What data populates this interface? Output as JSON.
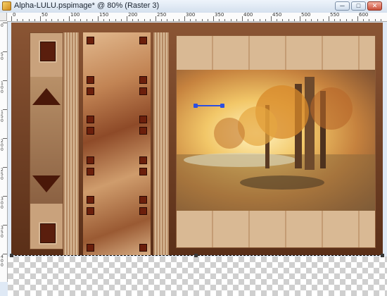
{
  "window": {
    "title": "Alpha-LULU.pspimage* @  80% (Raster 3)",
    "minimize_glyph": "─",
    "maximize_glyph": "□",
    "close_glyph": "✕"
  },
  "ruler_top": {
    "labels": [
      "0",
      "50",
      "100",
      "150",
      "200",
      "250",
      "300",
      "350",
      "400",
      "450",
      "500",
      "550",
      "600",
      "650"
    ]
  },
  "ruler_left": {
    "labels": [
      "0",
      "50",
      "100",
      "150",
      "200",
      "250",
      "300",
      "350",
      "400",
      "450"
    ]
  },
  "canvas": {
    "layer_name": "Raster 3",
    "zoom": "80%"
  },
  "colors": {
    "frame_dark": "#5a2f18",
    "frame_tan": "#c9a27c",
    "button_maroon": "#5a1e0d",
    "vector_node": "#2d4fe0"
  }
}
